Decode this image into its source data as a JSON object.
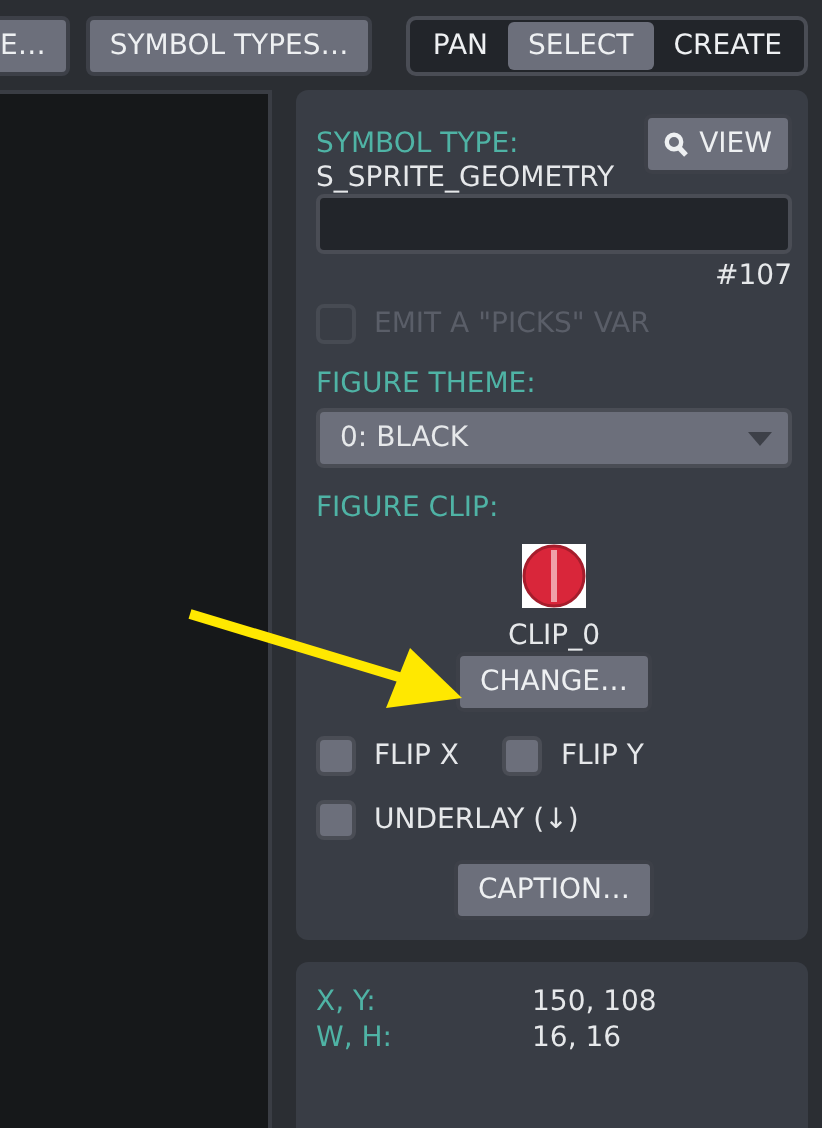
{
  "toolbar": {
    "buttons": [
      {
        "label": "E…"
      },
      {
        "label": "SYMBOL TYPES…"
      }
    ],
    "modes": [
      {
        "label": "PAN",
        "selected": false
      },
      {
        "label": "SELECT",
        "selected": true
      },
      {
        "label": "CREATE",
        "selected": false
      }
    ]
  },
  "panel": {
    "symbol_type_label": "SYMBOL TYPE:",
    "view_button": "VIEW",
    "symbol_type": "S_SPRITE_GEOMETRY",
    "id": "#107",
    "emit_checkbox": {
      "label": "EMIT A \"PICKS\" VAR",
      "checked": false,
      "disabled": true
    },
    "figure_theme_label": "FIGURE THEME:",
    "figure_theme": "0: BLACK",
    "figure_clip_label": "FIGURE CLIP:",
    "clip_name": "CLIP_0",
    "change_button": "CHANGE…",
    "flips": [
      {
        "label": "FLIP X",
        "checked": false
      },
      {
        "label": "FLIP Y",
        "checked": false
      }
    ],
    "underlay": {
      "label": "UNDERLAY (↓)",
      "checked": false
    },
    "caption_button": "CAPTION…"
  },
  "info": [
    {
      "label": "X, Y:",
      "value": "150, 108"
    },
    {
      "label": "W, H:",
      "value": "16, 16"
    }
  ]
}
